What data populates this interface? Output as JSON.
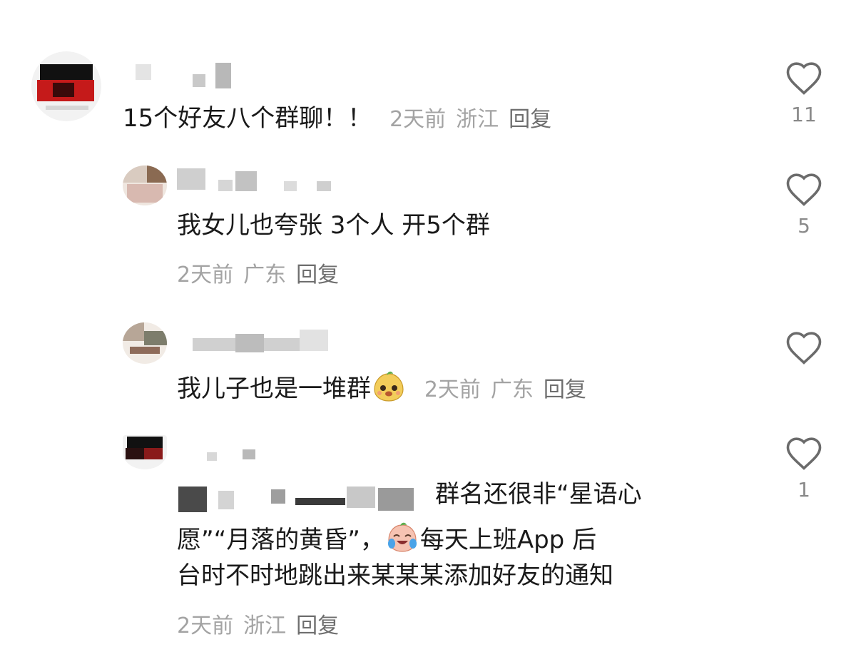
{
  "comments": [
    {
      "text": "15个好友八个群聊！！",
      "time": "2天前",
      "location": "浙江",
      "reply_label": "回复",
      "likes": "11"
    },
    {
      "text": "我女儿也夸张 3个人 开5个群",
      "time": "2天前",
      "location": "广东",
      "reply_label": "回复",
      "likes": "5"
    },
    {
      "text": "我儿子也是一堆群",
      "time": "2天前",
      "location": "广东",
      "reply_label": "回复",
      "likes": ""
    },
    {
      "text_line1": "群名还很非“星语心",
      "text_line2a": "愿”“月落的黄昏”，",
      "text_line2b": "每天上班App 后",
      "text_line3": "台时不时地跳出来某某某添加好友的通知",
      "time": "2天前",
      "location": "浙江",
      "reply_label": "回复",
      "likes": "1"
    }
  ],
  "icons": {
    "like": "heart-outline-icon",
    "emoji_1": "yellow-mascot-emoji",
    "emoji_2": "crying-laughing-emoji"
  },
  "colors": {
    "text": "#1a1a1a",
    "meta": "#a3a3a3",
    "reply": "#6e6e6e",
    "heart": "#6b6b6b"
  }
}
